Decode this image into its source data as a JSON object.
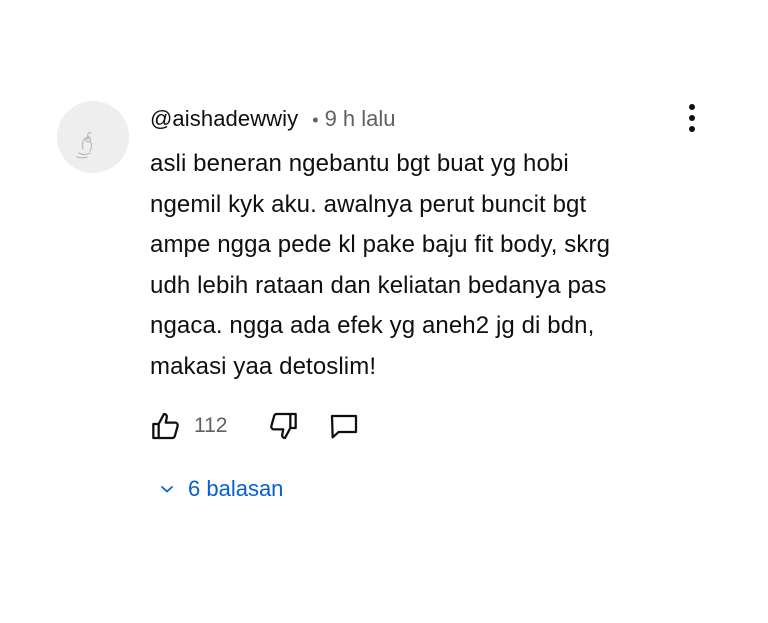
{
  "comment": {
    "author": "@aishadewwiy",
    "separator": "•",
    "time": "9 h lalu",
    "text_lines": [
      "asli beneran ngebantu bgt buat yg hobi",
      "ngemil kyk aku. awalnya perut buncit bgt",
      "ampe ngga pede kl pake baju fit body, skrg",
      "udh lebih rataan dan keliatan bedanya pas",
      "ngaca. ngga ada efek yg aneh2 jg di bdn,",
      "makasi yaa detoslim!"
    ],
    "like_count": "112",
    "replies_label": "6 balasan"
  },
  "icons": {
    "avatar": "avatar-drawing-icon",
    "menu": "more-vertical-icon",
    "like": "thumbs-up-icon",
    "dislike": "thumbs-down-icon",
    "reply": "comment-bubble-icon",
    "replies": "chevron-down-icon"
  },
  "colors": {
    "text": "#0f0f0f",
    "secondary": "#606060",
    "link": "#065fd4",
    "avatar_bg": "#eeeeee"
  }
}
